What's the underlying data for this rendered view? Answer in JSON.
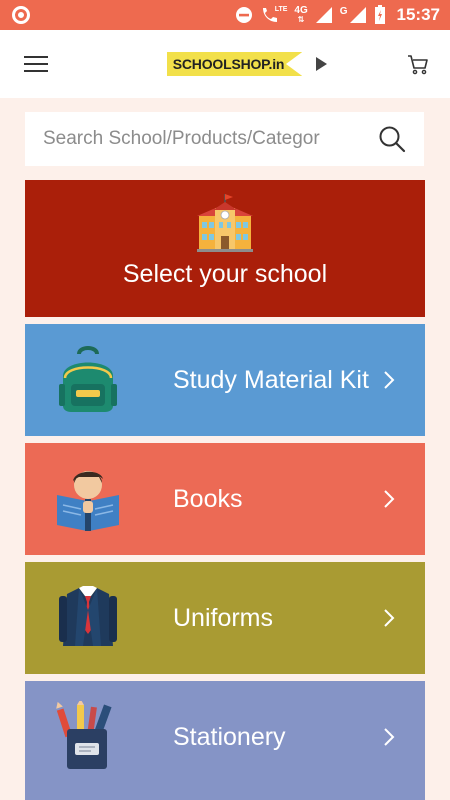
{
  "status_bar": {
    "time": "15:37",
    "network_primary": "4G",
    "network_secondary": "G",
    "volte_badge": "LTE",
    "icons": [
      "notification-dot-icon",
      "do-not-disturb-icon",
      "volte-call-icon",
      "signal-icon",
      "battery-icon"
    ]
  },
  "header": {
    "logo_text": "SCHOOLSHOP.in",
    "icons": [
      "menu-icon",
      "play-icon",
      "cart-icon"
    ]
  },
  "search": {
    "placeholder": "Search School/Products/Categor"
  },
  "school_card": {
    "label": "Select your school",
    "color": "#aa1f0a",
    "icon": "school-building-icon"
  },
  "categories": [
    {
      "label": "Study Material Kit",
      "color": "#5a9ad3",
      "icon": "backpack-icon"
    },
    {
      "label": "Books",
      "color": "#ec6a55",
      "icon": "reading-boy-icon"
    },
    {
      "label": "Uniforms",
      "color": "#a99b33",
      "icon": "uniform-blazer-icon"
    },
    {
      "label": "Stationery",
      "color": "#8594c6",
      "icon": "pencil-holder-icon"
    }
  ],
  "colors": {
    "status_bar": "#ee6a4f",
    "background": "#fdf0ea",
    "logo_yellow": "#f2e04a"
  }
}
